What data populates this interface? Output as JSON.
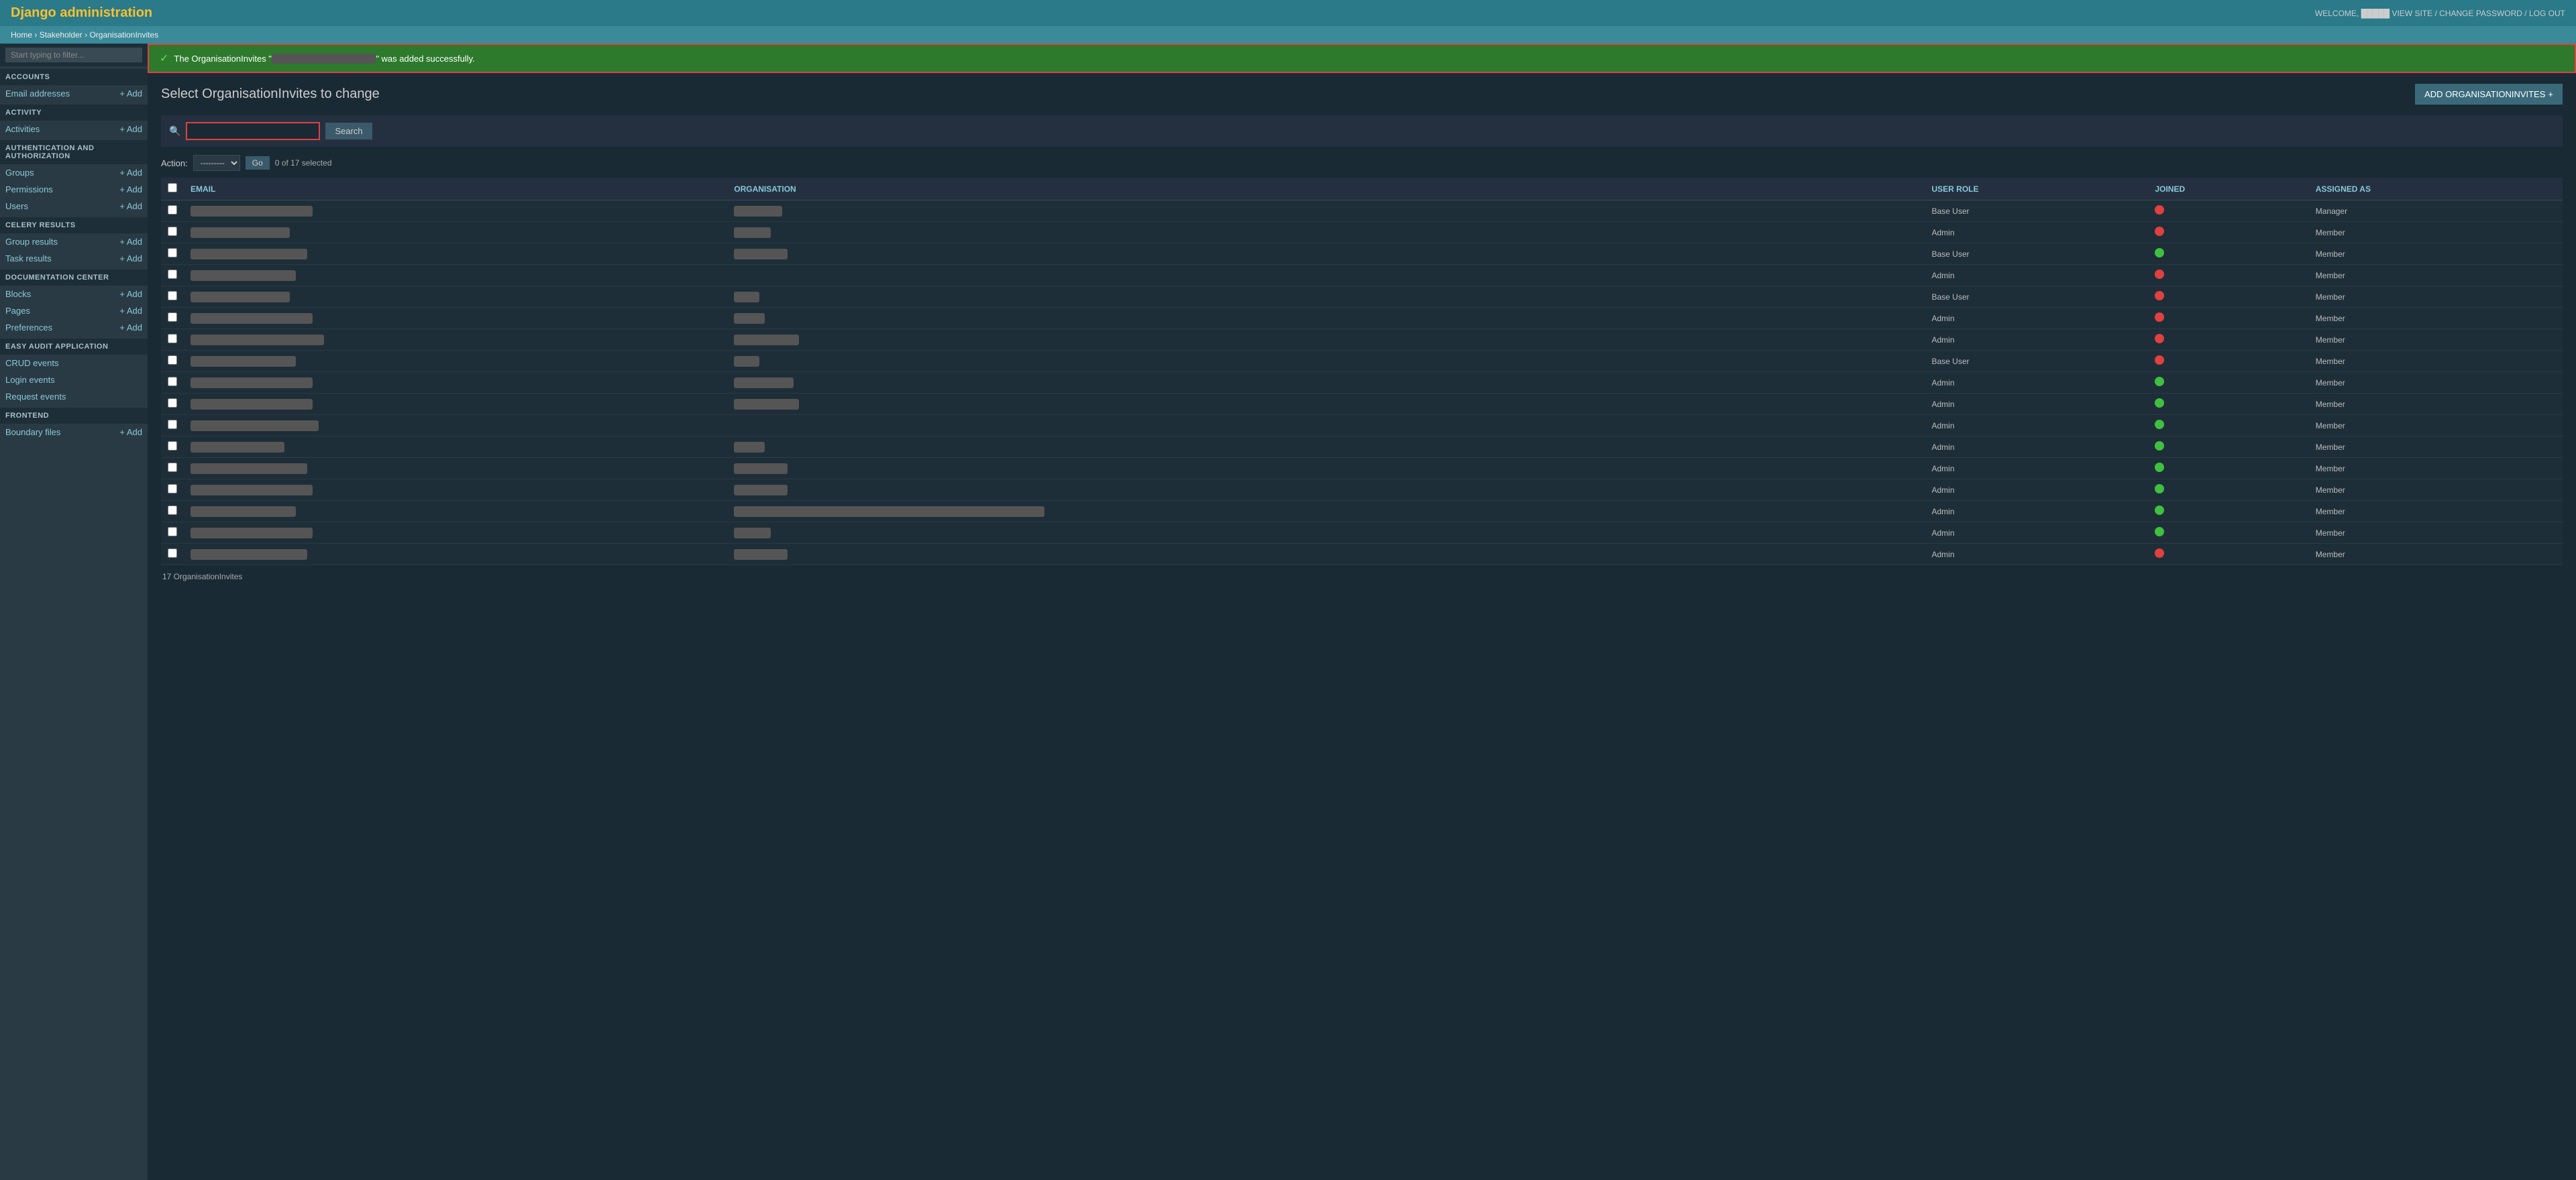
{
  "header": {
    "title": "Django administration",
    "welcome_text": "WELCOME,",
    "username": "█████",
    "view_site": "VIEW SITE",
    "change_password": "CHANGE PASSWORD",
    "log_out": "LOG OUT"
  },
  "breadcrumb": {
    "home": "Home",
    "stakeholder": "Stakeholder",
    "current": "OrganisationInvites"
  },
  "sidebar": {
    "filter_placeholder": "Start typing to filter...",
    "sections": [
      {
        "name": "ACCOUNTS",
        "items": [
          {
            "label": "Email addresses",
            "add": true
          }
        ]
      },
      {
        "name": "ACTIVITY",
        "items": [
          {
            "label": "Activities",
            "add": true
          }
        ]
      },
      {
        "name": "AUTHENTICATION AND AUTHORIZATION",
        "items": [
          {
            "label": "Groups",
            "add": true
          },
          {
            "label": "Permissions",
            "add": true
          },
          {
            "label": "Users",
            "add": true
          }
        ]
      },
      {
        "name": "CELERY RESULTS",
        "items": [
          {
            "label": "Group results",
            "add": true
          },
          {
            "label": "Task results",
            "add": true
          }
        ]
      },
      {
        "name": "DOCUMENTATION CENTER",
        "items": [
          {
            "label": "Blocks",
            "add": true
          },
          {
            "label": "Pages",
            "add": true
          },
          {
            "label": "Preferences",
            "add": true
          }
        ]
      },
      {
        "name": "EASY AUDIT APPLICATION",
        "items": [
          {
            "label": "CRUD events",
            "add": false
          },
          {
            "label": "Login events",
            "add": false
          },
          {
            "label": "Request events",
            "add": false
          }
        ]
      },
      {
        "name": "FRONTEND",
        "items": [
          {
            "label": "Boundary files",
            "add": true
          }
        ]
      }
    ]
  },
  "success_message": {
    "text_start": "The OrganisationInvites \"",
    "highlighted": "████████████████",
    "text_end": "\" was added successfully."
  },
  "content": {
    "page_title": "Select OrganisationInvites to change",
    "add_button_label": "ADD ORGANISATIONINVITES",
    "search_placeholder": "",
    "search_button": "Search",
    "action_default": "---------",
    "go_button": "Go",
    "selected_text": "0 of 17 selected",
    "action_label": "Action:",
    "columns": {
      "checkbox": "",
      "email": "EMAIL",
      "organisation": "ORGANISATION",
      "user_role": "USER ROLE",
      "joined": "JOINED",
      "assigned_as": "ASSIGNED AS"
    },
    "rows": [
      {
        "email": "████████████████████",
        "organisation": "███████",
        "user_role": "Base User",
        "joined": "red",
        "assigned_as": "Manager"
      },
      {
        "email": "████████████████",
        "organisation": "█████",
        "user_role": "Admin",
        "joined": "red",
        "assigned_as": "Member"
      },
      {
        "email": "███████████████████",
        "organisation": "████████",
        "user_role": "Base User",
        "joined": "green",
        "assigned_as": "Member"
      },
      {
        "email": "█████████████████",
        "organisation": "",
        "user_role": "Admin",
        "joined": "red",
        "assigned_as": "Member"
      },
      {
        "email": "████████████████",
        "organisation": "███",
        "user_role": "Base User",
        "joined": "red",
        "assigned_as": "Member"
      },
      {
        "email": "████████████████████",
        "organisation": "████",
        "user_role": "Admin",
        "joined": "red",
        "assigned_as": "Member"
      },
      {
        "email": "██████████████████████",
        "organisation": "██████████",
        "user_role": "Admin",
        "joined": "red",
        "assigned_as": "Member"
      },
      {
        "email": "█████████████████",
        "organisation": "███",
        "user_role": "Base User",
        "joined": "red",
        "assigned_as": "Member"
      },
      {
        "email": "████████████████████",
        "organisation": "█████████",
        "user_role": "Admin",
        "joined": "green",
        "assigned_as": "Member"
      },
      {
        "email": "████████████████████",
        "organisation": "██████████",
        "user_role": "Admin",
        "joined": "green",
        "assigned_as": "Member"
      },
      {
        "email": "█████████████████████",
        "organisation": "",
        "user_role": "Admin",
        "joined": "green",
        "assigned_as": "Member"
      },
      {
        "email": "███████████████",
        "organisation": "████",
        "user_role": "Admin",
        "joined": "green",
        "assigned_as": "Member"
      },
      {
        "email": "███████████████████",
        "organisation": "████████",
        "user_role": "Admin",
        "joined": "green",
        "assigned_as": "Member"
      },
      {
        "email": "████████████████████",
        "organisation": "████████",
        "user_role": "Admin",
        "joined": "green",
        "assigned_as": "Member"
      },
      {
        "email": "█████████████████",
        "organisation": "█████████████████████████████████████████████████████",
        "user_role": "Admin",
        "joined": "green",
        "assigned_as": "Member"
      },
      {
        "email": "████████████████████",
        "organisation": "█████",
        "user_role": "Admin",
        "joined": "green",
        "assigned_as": "Member"
      },
      {
        "email": "███████████████████",
        "organisation": "████████",
        "user_role": "Admin",
        "joined": "red",
        "assigned_as": "Member"
      }
    ],
    "footer_text": "17 OrganisationInvites"
  }
}
